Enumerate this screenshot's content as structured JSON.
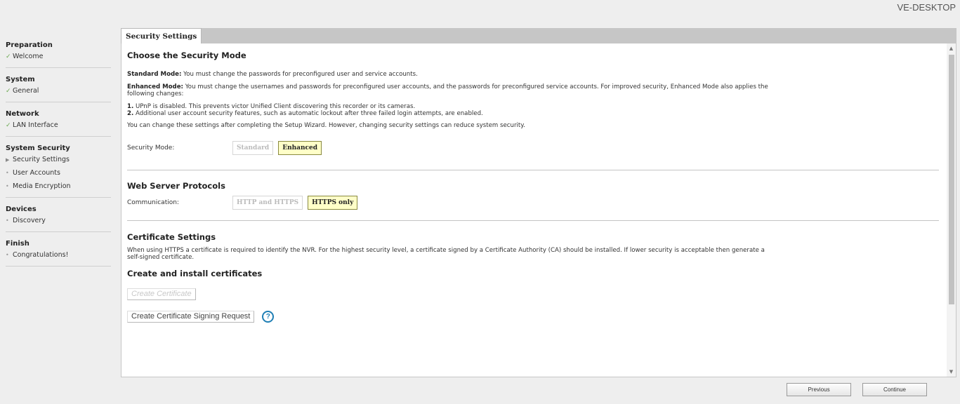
{
  "header": {
    "host_name": "VE-DESKTOP"
  },
  "sidebar": {
    "groups": [
      {
        "title": "Preparation",
        "items": [
          {
            "label": "Welcome",
            "status": "done"
          }
        ]
      },
      {
        "title": "System",
        "items": [
          {
            "label": "General",
            "status": "done"
          }
        ]
      },
      {
        "title": "Network",
        "items": [
          {
            "label": "LAN Interface",
            "status": "done"
          }
        ]
      },
      {
        "title": "System Security",
        "items": [
          {
            "label": "Security Settings",
            "status": "current"
          },
          {
            "label": "User Accounts",
            "status": "pending"
          },
          {
            "label": "Media Encryption",
            "status": "pending"
          }
        ]
      },
      {
        "title": "Devices",
        "items": [
          {
            "label": "Discovery",
            "status": "pending"
          }
        ]
      },
      {
        "title": "Finish",
        "items": [
          {
            "label": "Congratulations!",
            "status": "pending"
          }
        ]
      }
    ]
  },
  "tab": {
    "label": "Security Settings"
  },
  "security_mode": {
    "heading": "Choose the Security Mode",
    "standard_label": "Standard Mode:",
    "standard_text": " You must change the passwords for preconfigured user and service accounts.",
    "enhanced_label": "Enhanced Mode:",
    "enhanced_text": " You must change the usernames and passwords for preconfigured user accounts, and the passwords for preconfigured service accounts. For improved security, Enhanced Mode also applies the following changes:",
    "change1_num": "1.",
    "change1_text": " UPnP is disabled. This prevents victor Unified Client discovering this recorder or its cameras.",
    "change2_num": "2.",
    "change2_text": " Additional user account security features, such as automatic lockout after three failed login attempts, are enabled.",
    "note": "You can change these settings after completing the Setup Wizard. However, changing security settings can reduce system security.",
    "field_label": "Security Mode:",
    "options": [
      "Standard",
      "Enhanced"
    ],
    "selected": "Enhanced"
  },
  "web_server": {
    "heading": "Web Server Protocols",
    "field_label": "Communication:",
    "options": [
      "HTTP and HTTPS",
      "HTTPS only"
    ],
    "selected": "HTTPS only"
  },
  "certificate": {
    "heading": "Certificate Settings",
    "description": "When using HTTPS a certificate is required to identify the NVR. For the highest security level, a certificate signed by a Certificate Authority (CA) should be installed. If lower security is acceptable then generate a self-signed certificate.",
    "subheading": "Create and install certificates",
    "create_button": "Create Certificate",
    "csr_button": "Create Certificate Signing Request",
    "help_glyph": "?"
  },
  "footer": {
    "previous": "Previous",
    "continue": "Continue"
  },
  "colors": {
    "selected_fill": "#ffffc8",
    "help_blue": "#1f7fb5",
    "check_green": "#6aa84f"
  }
}
